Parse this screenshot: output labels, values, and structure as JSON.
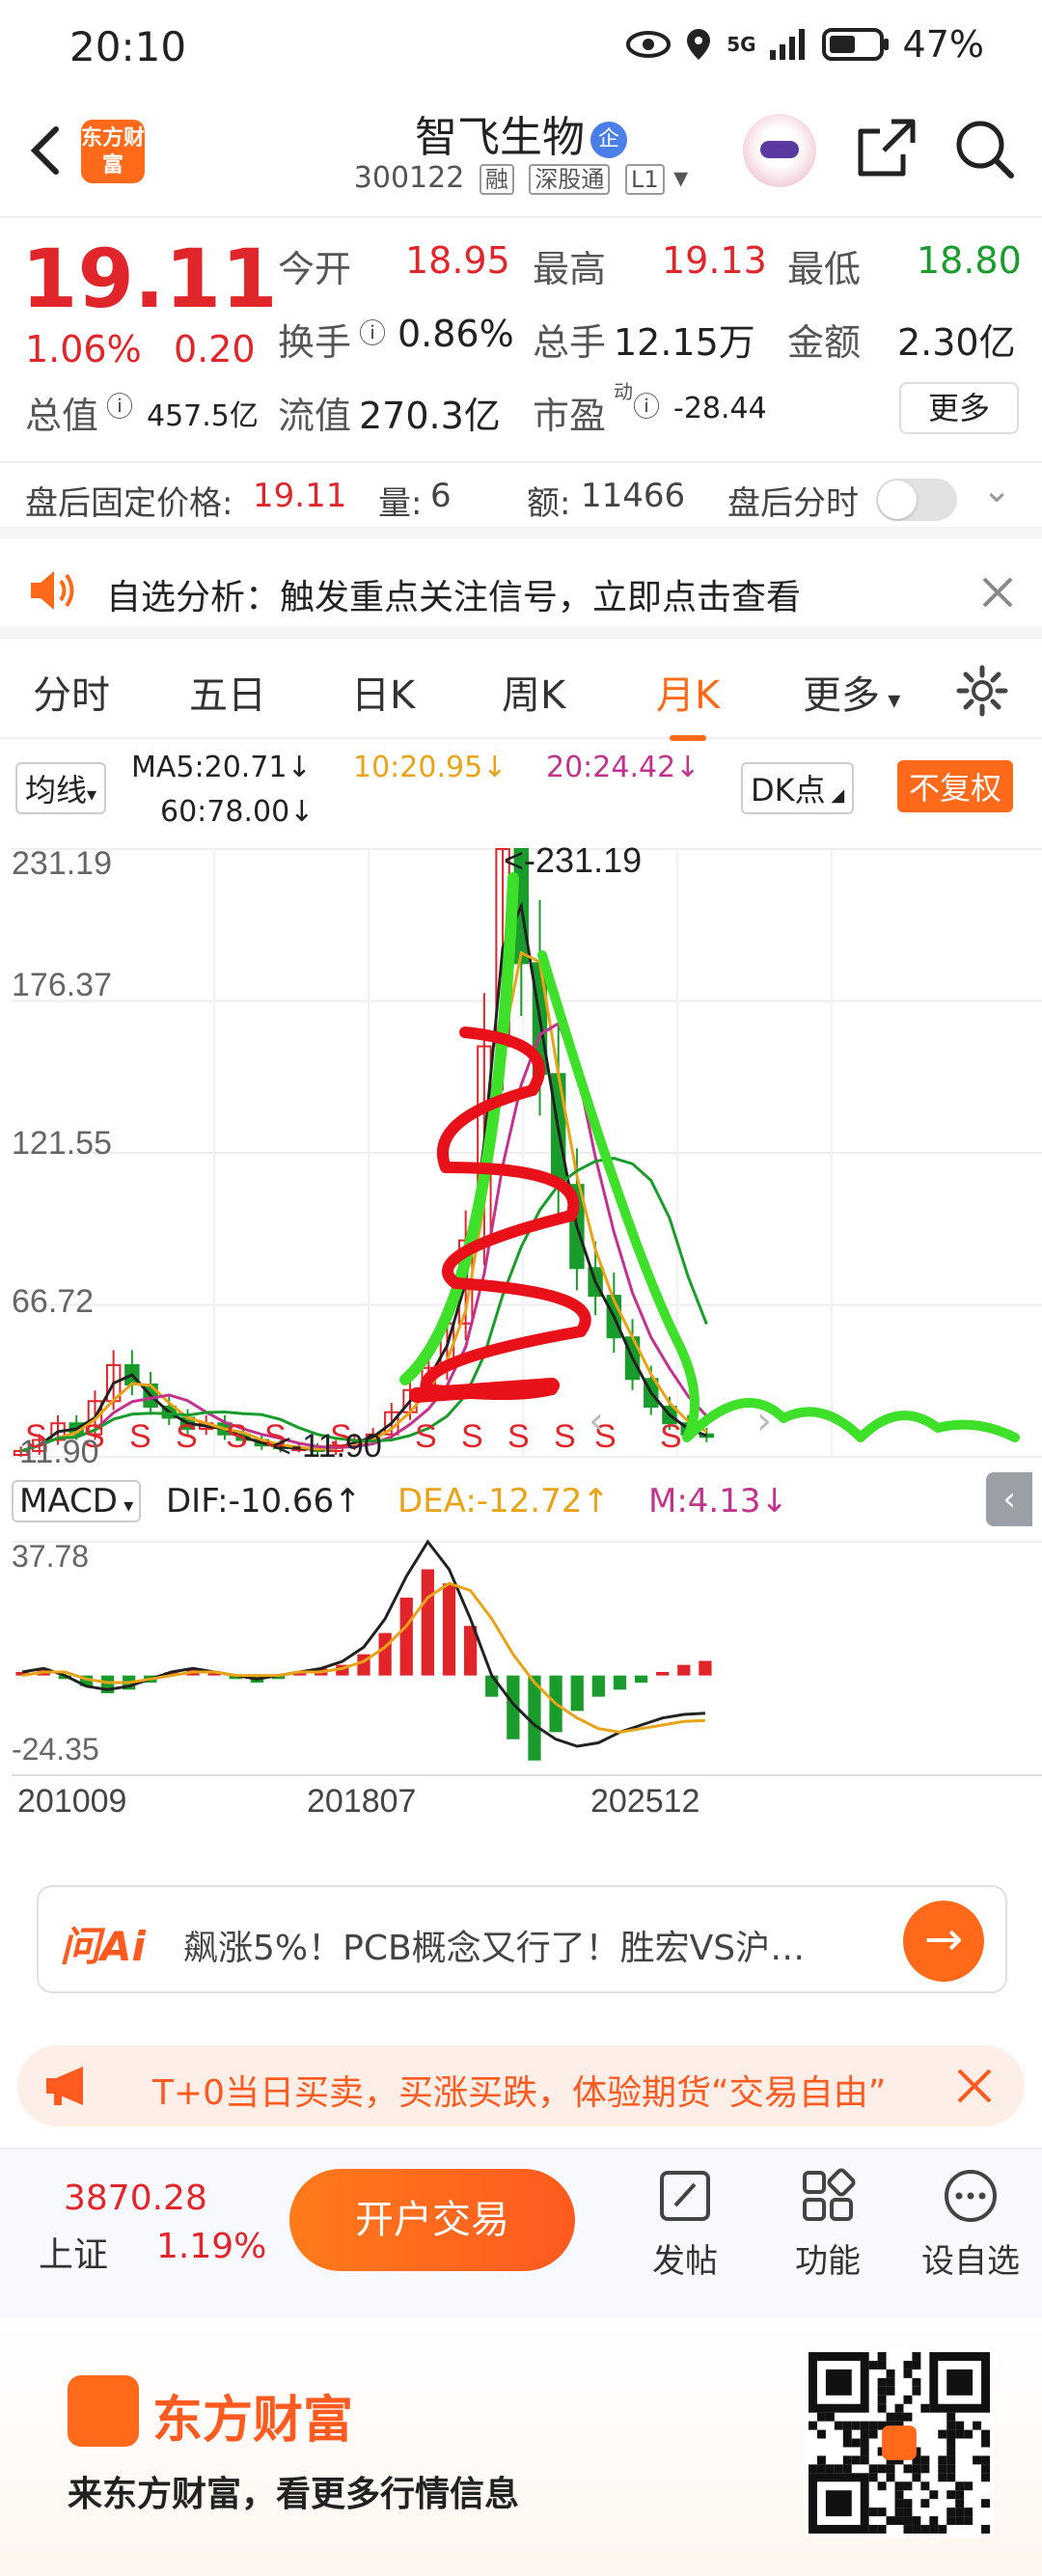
{
  "status_bar": {
    "time": "20:10",
    "battery": "47%",
    "network": "5G"
  },
  "header": {
    "stock_name": "智飞生物",
    "enterprise_badge": "企",
    "code": "300122",
    "tags": [
      "融",
      "深股通",
      "L1"
    ],
    "logo_text": "东方财富"
  },
  "quote": {
    "price": "19.11",
    "change_pct": "1.06%",
    "change": "0.20",
    "open_label": "今开",
    "open": "18.95",
    "high_label": "最高",
    "high": "19.13",
    "low_label": "最低",
    "low": "18.80",
    "turnover_label": "换手",
    "turnover": "0.86%",
    "volume_label": "总手",
    "volume": "12.15万",
    "amount_label": "金额",
    "amount": "2.30亿",
    "mcap_label": "总值",
    "mcap": "457.5亿",
    "float_label": "流值",
    "float_cap": "270.3亿",
    "pe_label": "市盈",
    "pe_sup": "动",
    "pe": "-28.44",
    "more": "更多"
  },
  "after_hours": {
    "price_label": "盘后固定价格:",
    "price": "19.11",
    "qty_label": "量:",
    "qty": "6",
    "amt_label": "额:",
    "amt": "11466",
    "timeshare_label": "盘后分时"
  },
  "banner": {
    "text": "自选分析：触发重点关注信号，立即点击查看"
  },
  "tabs": [
    {
      "label": "分时"
    },
    {
      "label": "五日"
    },
    {
      "label": "日K"
    },
    {
      "label": "周K"
    },
    {
      "label": "月K"
    },
    {
      "label": "更多"
    }
  ],
  "ma_row": {
    "selector": "均线",
    "ma5": "MA5:20.71↓",
    "ma10": "10:20.95↓",
    "ma20": "20:24.42↓",
    "ma60": "60:78.00↓",
    "dk": "DK点",
    "adjust": "不复权"
  },
  "chart_data": [
    {
      "type": "candlestick",
      "y_ticks": [
        "231.19",
        "176.37",
        "121.55",
        "66.72",
        "11.90"
      ],
      "ylim": [
        11.9,
        231.19
      ],
      "annotations": [
        "<-231.19",
        "<-11.90"
      ],
      "signal_markers": "S",
      "series": [
        {
          "name": "MA5",
          "color": "#222222"
        },
        {
          "name": "MA10",
          "color": "#e8a317"
        },
        {
          "name": "MA20",
          "color": "#c2338f"
        },
        {
          "name": "MA60",
          "color": "#1a9c2d"
        }
      ],
      "close_values": [
        14,
        18,
        24,
        20,
        32,
        45,
        38,
        30,
        26,
        22,
        24,
        20,
        18,
        16,
        15,
        15,
        14,
        16,
        18,
        20,
        28,
        36,
        44,
        60,
        90,
        160,
        231.19,
        190,
        150,
        110,
        80,
        70,
        55,
        40,
        30,
        24,
        20,
        19.11
      ]
    },
    {
      "type": "bar",
      "title": "MACD",
      "dif": "DIF:-10.66↑",
      "dea": "DEA:-12.72↑",
      "m": "M:4.13↓",
      "y_ticks": [
        "37.78",
        "-24.35"
      ],
      "ylim": [
        -24.35,
        37.78
      ],
      "x_ticks": [
        "201009",
        "201807",
        "202512"
      ],
      "hist": [
        1,
        2,
        -1,
        -3,
        -5,
        -4,
        -2,
        1,
        2,
        1,
        -1,
        -2,
        -1,
        1,
        2,
        3,
        6,
        12,
        22,
        30,
        26,
        14,
        -6,
        -18,
        -24,
        -16,
        -10,
        -6,
        -4,
        -2,
        1,
        3,
        4.13
      ],
      "dif_values": [
        1,
        2,
        0,
        -3,
        -4,
        -3,
        -1,
        1,
        2,
        1,
        0,
        -1,
        0,
        1,
        2,
        4,
        8,
        16,
        28,
        37.78,
        30,
        16,
        0,
        -8,
        -14,
        -18,
        -20,
        -19,
        -16,
        -14,
        -12,
        -11,
        -10.66
      ],
      "dea_values": [
        0,
        1,
        1,
        -1,
        -2,
        -2,
        -1,
        0,
        1,
        1,
        0,
        0,
        0,
        1,
        1,
        2,
        4,
        8,
        14,
        22,
        26,
        24,
        16,
        6,
        -2,
        -8,
        -12,
        -15,
        -16,
        -15,
        -14,
        -13,
        -12.72
      ]
    }
  ],
  "ai_search": {
    "logo": "问Ai",
    "text": "飙涨5%！PCB概念又行了！胜宏VS沪…"
  },
  "promo": {
    "text": "T+0当日买卖，买涨买跌，体验期货“交易自由”"
  },
  "bottom_bar": {
    "index_value": "3870.28",
    "index_name": "上证",
    "index_pct": "1.19%",
    "trade": "开户交易",
    "post": "发帖",
    "func": "功能",
    "watch": "设自选"
  },
  "footer": {
    "brand": "东方财富",
    "slogan": "来东方财富，看更多行情信息"
  },
  "colors": {
    "up": "#e0262b",
    "down": "#1a9c2d",
    "accent": "#ff6a1a"
  }
}
